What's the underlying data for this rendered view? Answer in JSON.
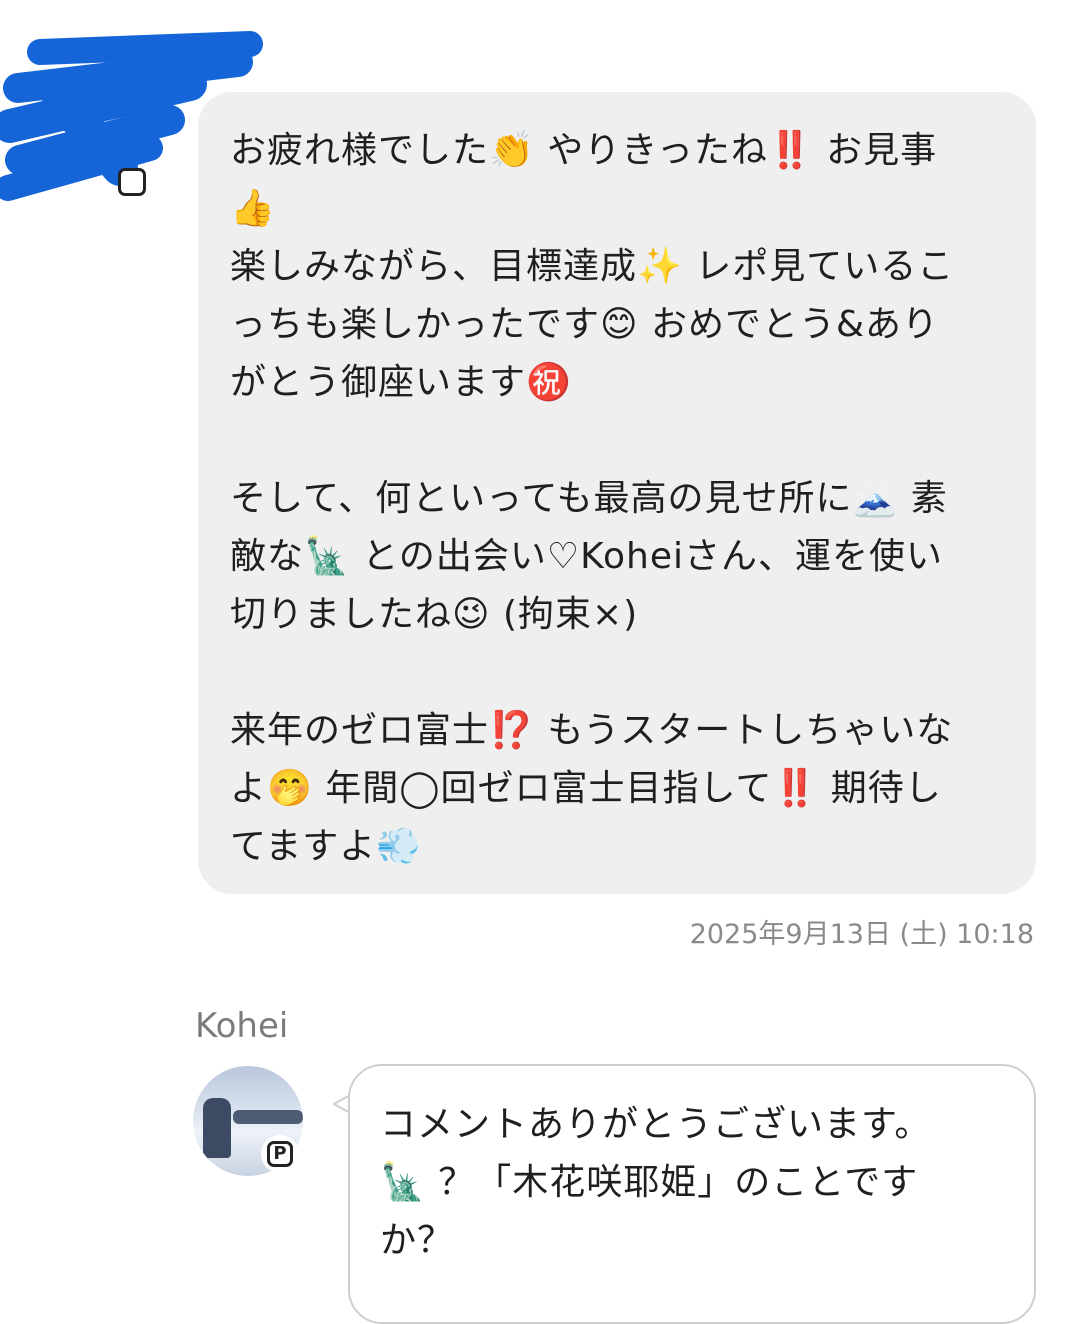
{
  "comment": {
    "lines": [
      "お疲れ様でした👏 やりきったね‼️ お見事",
      "👍",
      "楽しみながら、目標達成✨ レポ見ているこ",
      "っちも楽しかったです😊 おめでとう&あり",
      "がとう御座います㊗️",
      "",
      "そして、何といっても最高の見せ所に🗻 素",
      "敵な🗽 との出会い♡Koheiさん、運を使い",
      "切りましたね😉 (拘束×)",
      "",
      "来年のゼロ富士⁉️ もうスタートしちゃいな",
      "よ🤭 年間◯回ゼロ富士目指して‼️ 期待し",
      "てますよ💨"
    ],
    "timestamp": "2025年9月13日 (土) 10:18"
  },
  "reply": {
    "username": "Kohei",
    "badge": "P",
    "lines": [
      "コメントありがとうございます。",
      "🗽 ？「木花咲耶姫」のことです",
      "か？"
    ]
  },
  "colors": {
    "scribble": "#1565d8",
    "comment_bubble": "#efeff0",
    "reply_border": "#cfcfcf",
    "meta_text": "#8a8a8a"
  }
}
